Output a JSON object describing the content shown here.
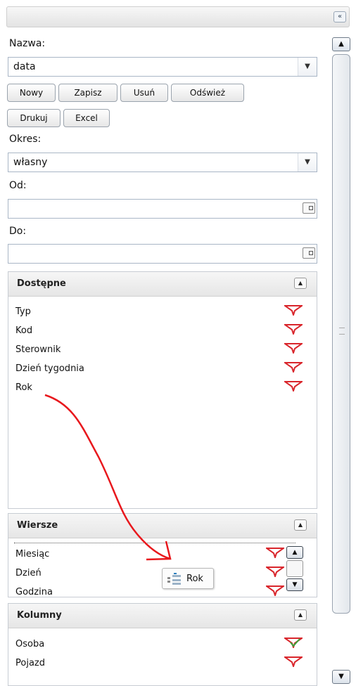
{
  "header": {
    "collapse_icon": "double-chevron-left-icon",
    "collapse_label": "«"
  },
  "form": {
    "name_label": "Nazwa:",
    "name_value": "data",
    "buttons": [
      "Nowy",
      "Zapisz",
      "Usuń",
      "Odśwież",
      "Drukuj",
      "Excel"
    ],
    "period_label": "Okres:",
    "period_value": "własny",
    "from_label": "Od:",
    "from_value": "",
    "to_label": "Do:",
    "to_value": ""
  },
  "available": {
    "title": "Dostępne",
    "items": [
      "Typ",
      "Kod",
      "Sterownik",
      "Dzień tygodnia",
      "Rok"
    ]
  },
  "rows": {
    "title": "Wiersze",
    "items": [
      "Miesiąc",
      "Dzień",
      "Godzina"
    ]
  },
  "columns": {
    "title": "Kolumny",
    "items": [
      "Osoba",
      "Pojazd"
    ]
  },
  "drag": {
    "label": "Rok",
    "arrow_color": "#e8181d"
  },
  "colors": {
    "filter_red": "#d9262c",
    "filter_check": "#3aa33a",
    "border": "#a9b6c6"
  }
}
